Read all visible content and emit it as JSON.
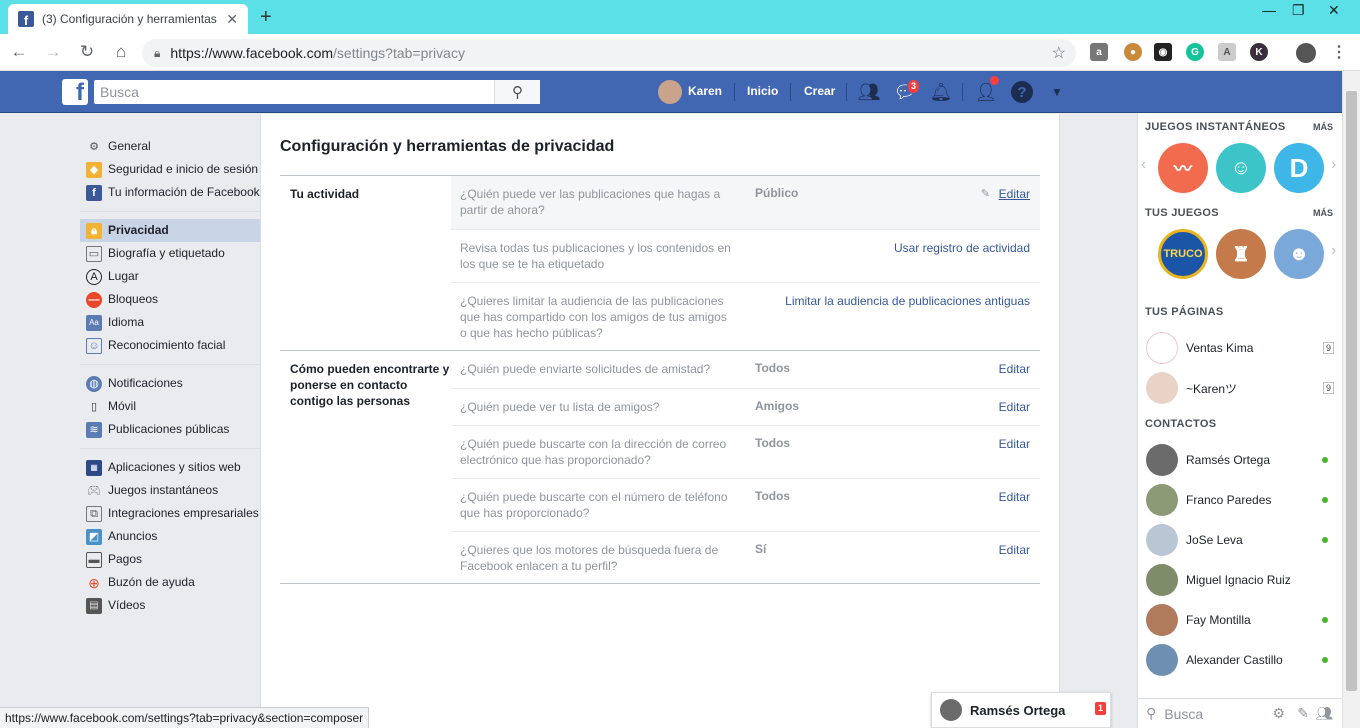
{
  "browser": {
    "tab_title": "(3) Configuración y herramientas",
    "favicon": "f",
    "url_host": "https://www.facebook.com",
    "url_path": "/settings?tab=privacy",
    "status_url": "https://www.facebook.com/settings?tab=privacy&section=composer"
  },
  "fb_header": {
    "search_placeholder": "Busca",
    "profile_name": "Karen",
    "home": "Inicio",
    "create": "Crear",
    "messages_badge": "3",
    "accent": "#4267b2"
  },
  "left_nav": {
    "group1": [
      {
        "label": "General",
        "icon": "gear-icon"
      },
      {
        "label": "Seguridad e inicio de sesión",
        "icon": "shield-icon"
      },
      {
        "label": "Tu información de Facebook",
        "icon": "facebook-icon"
      }
    ],
    "group2": [
      {
        "label": "Privacidad",
        "icon": "lock-icon",
        "active": true
      },
      {
        "label": "Biografía y etiquetado",
        "icon": "timeline-icon"
      },
      {
        "label": "Lugar",
        "icon": "location-icon"
      },
      {
        "label": "Bloqueos",
        "icon": "block-icon"
      },
      {
        "label": "Idioma",
        "icon": "language-icon"
      },
      {
        "label": "Reconocimiento facial",
        "icon": "face-icon"
      }
    ],
    "group3": [
      {
        "label": "Notificaciones",
        "icon": "globe-icon"
      },
      {
        "label": "Móvil",
        "icon": "mobile-icon"
      },
      {
        "label": "Publicaciones públicas",
        "icon": "rss-icon"
      }
    ],
    "group4": [
      {
        "label": "Aplicaciones y sitios web",
        "icon": "apps-icon"
      },
      {
        "label": "Juegos instantáneos",
        "icon": "gamepad-icon"
      },
      {
        "label": "Integraciones empresariales",
        "icon": "integrations-icon"
      },
      {
        "label": "Anuncios",
        "icon": "ads-icon"
      },
      {
        "label": "Pagos",
        "icon": "card-icon"
      },
      {
        "label": "Buzón de ayuda",
        "icon": "lifebuoy-icon"
      },
      {
        "label": "Vídeos",
        "icon": "film-icon"
      }
    ]
  },
  "main": {
    "title": "Configuración y herramientas de privacidad",
    "sections": [
      {
        "heading": "Tu actividad",
        "rows": [
          {
            "question": "¿Quién puede ver las publicaciones que hagas a partir de ahora?",
            "value": "Público",
            "action": "Editar"
          },
          {
            "question": "Revisa todas tus publicaciones y los contenidos en los que se te ha etiquetado",
            "value": "",
            "action": "Usar registro de actividad"
          },
          {
            "question": "¿Quieres limitar la audiencia de las publicaciones que has compartido con los amigos de tus amigos o que has hecho públicas?",
            "value": "",
            "action": "Limitar la audiencia de publicaciones antiguas"
          }
        ]
      },
      {
        "heading": "Cómo pueden encontrarte y ponerse en contacto contigo las personas",
        "rows": [
          {
            "question": "¿Quién puede enviarte solicitudes de amistad?",
            "value": "Todos",
            "action": "Editar"
          },
          {
            "question": "¿Quién puede ver tu lista de amigos?",
            "value": "Amigos",
            "action": "Editar"
          },
          {
            "question": "¿Quién puede buscarte con la dirección de correo electrónico que has proporcionado?",
            "value": "Todos",
            "action": "Editar"
          },
          {
            "question": "¿Quién puede buscarte con el número de teléfono que has proporcionado?",
            "value": "Todos",
            "action": "Editar"
          },
          {
            "question": "¿Quieres que los motores de búsqueda fuera de Facebook enlacen a tu perfil?",
            "value": "Sí",
            "action": "Editar"
          }
        ]
      }
    ]
  },
  "right_col": {
    "instant_games": "JUEGOS INSTANTÁNEOS",
    "your_games": "TUS JUEGOS",
    "more": "MÁS",
    "truco": "TRUCO",
    "d_letter": "D",
    "your_pages": "TUS PÁGINAS",
    "pages": [
      {
        "name": "Ventas Kima",
        "count": "9"
      },
      {
        "name": "~Karenツ",
        "count": "9"
      }
    ],
    "contacts_head": "CONTACTOS",
    "contacts": [
      {
        "name": "Ramsés Ortega",
        "online": true
      },
      {
        "name": "Franco Paredes",
        "online": true
      },
      {
        "name": "JoSe Leva",
        "online": true
      },
      {
        "name": "Miguel Ignacio Ruiz",
        "online": false
      },
      {
        "name": "Fay Montilla",
        "online": true
      },
      {
        "name": "Alexander Castillo",
        "online": true
      }
    ],
    "search_placeholder": "Busca"
  },
  "chat": {
    "name": "Ramsés Ortega",
    "badge": "1"
  }
}
